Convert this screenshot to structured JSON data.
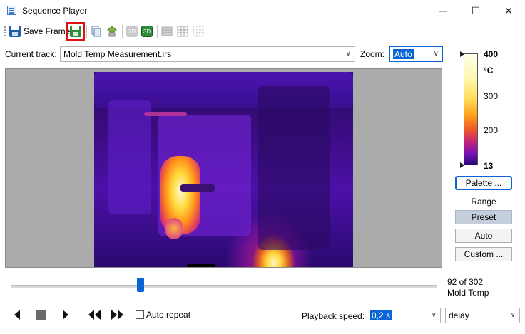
{
  "window": {
    "title": "Sequence Player",
    "minimize_glyph": "─",
    "maximize_glyph": "☐",
    "close_glyph": "✕"
  },
  "toolbar": {
    "save_frame_label": "Save Frame",
    "btn_2d_label": "2D",
    "btn_3d_label": "3D"
  },
  "track": {
    "label": "Current track:",
    "value": "Mold Temp Measurement.irs"
  },
  "zoom": {
    "label": "Zoom:",
    "value": "Auto"
  },
  "scale": {
    "max": "400",
    "unit": "°C",
    "tick_300": "300",
    "tick_200": "200",
    "min": "13"
  },
  "side_buttons": {
    "palette": "Palette ...",
    "range_label": "Range",
    "preset": "Preset",
    "auto": "Auto",
    "custom": "Custom ..."
  },
  "status": {
    "frame": "92 of 302",
    "name": "Mold Temp"
  },
  "playback": {
    "auto_repeat": "Auto repeat",
    "speed_label": "Playback speed:",
    "speed_value": "0,2 s",
    "mode_value": "delay"
  }
}
